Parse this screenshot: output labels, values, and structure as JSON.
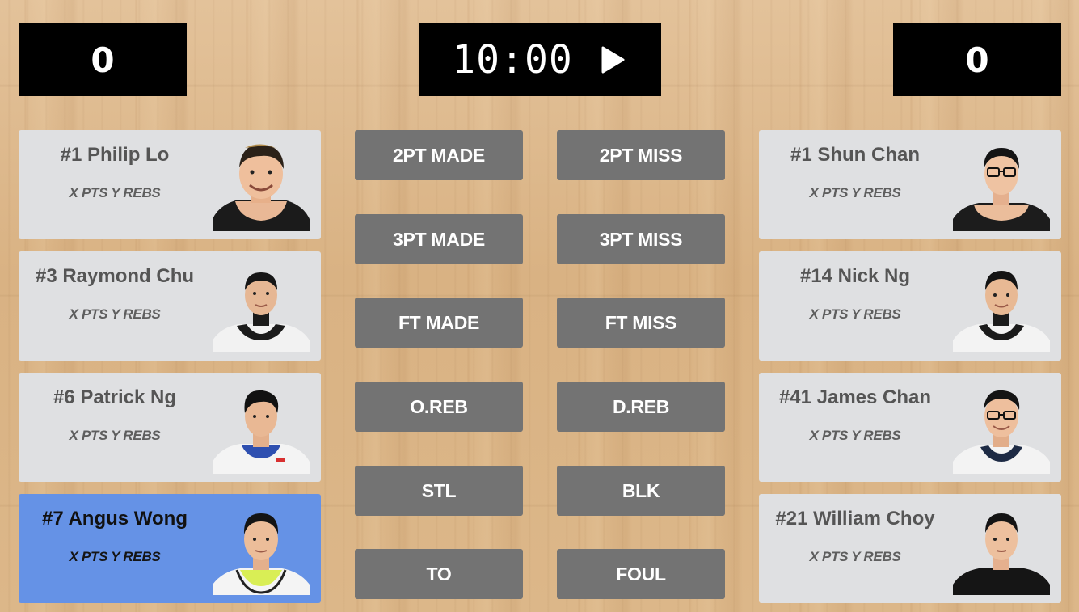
{
  "scoreboard": {
    "home_score": "0",
    "away_score": "0",
    "clock": "10:00",
    "play_icon": "play-icon"
  },
  "home_team": {
    "players": [
      {
        "name": "#1 Philip Lo",
        "stats": "X PTS Y REBS",
        "selected": false
      },
      {
        "name": "#3 Raymond Chu",
        "stats": "X PTS Y REBS",
        "selected": false
      },
      {
        "name": "#6 Patrick Ng",
        "stats": "X PTS Y REBS",
        "selected": false
      },
      {
        "name": "#7 Angus Wong",
        "stats": "X PTS Y REBS",
        "selected": true
      }
    ]
  },
  "away_team": {
    "players": [
      {
        "name": "#1 Shun Chan",
        "stats": "X PTS Y REBS",
        "selected": false
      },
      {
        "name": "#14 Nick Ng",
        "stats": "X PTS Y REBS",
        "selected": false
      },
      {
        "name": "#41 James Chan",
        "stats": "X PTS Y REBS",
        "selected": false
      },
      {
        "name": "#21 William Choy",
        "stats": "X PTS Y REBS",
        "selected": false
      }
    ]
  },
  "actions": {
    "two_pt_made": "2PT MADE",
    "two_pt_miss": "2PT MISS",
    "three_pt_made": "3PT MADE",
    "three_pt_miss": "3PT MISS",
    "ft_made": "FT MADE",
    "ft_miss": "FT MISS",
    "off_reb": "O.REB",
    "def_reb": "D.REB",
    "steal": "STL",
    "block": "BLK",
    "turnover": "TO",
    "foul": "FOUL"
  },
  "colors": {
    "selected_card": "#6592e6",
    "card": "#dfe0e2",
    "action_button": "#737373",
    "scoreboard": "#000000"
  }
}
